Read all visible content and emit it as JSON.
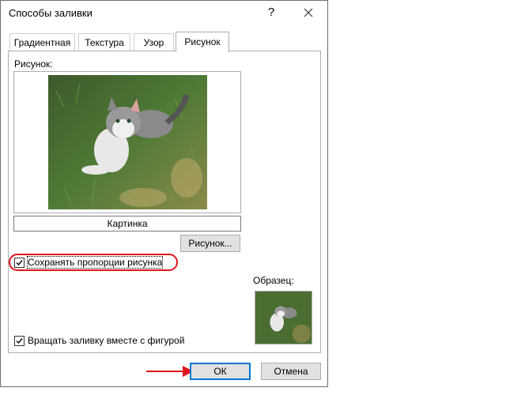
{
  "window": {
    "title": "Способы заливки",
    "help_glyph": "?",
    "close_icon": "close-icon"
  },
  "tabs": [
    {
      "label": "Градиентная",
      "active": false
    },
    {
      "label": "Текстура",
      "active": false
    },
    {
      "label": "Узор",
      "active": false
    },
    {
      "label": "Рисунок",
      "active": true
    }
  ],
  "picture_tab": {
    "picture_label": "Рисунок:",
    "picture_name": "Картинка",
    "picture_button": "Рисунок...",
    "keep_aspect_label": "Сохранять пропорции рисунка",
    "keep_aspect_checked": true,
    "rotate_with_shape_label": "Вращать заливку вместе с фигурой",
    "rotate_with_shape_checked": true,
    "sample_label": "Образец:"
  },
  "buttons": {
    "ok": "ОК",
    "cancel": "Отмена"
  },
  "annotations": {
    "highlight_color": "#e0141e",
    "arrow_color": "#e0141e"
  },
  "colors": {
    "accent": "#0078d7"
  }
}
